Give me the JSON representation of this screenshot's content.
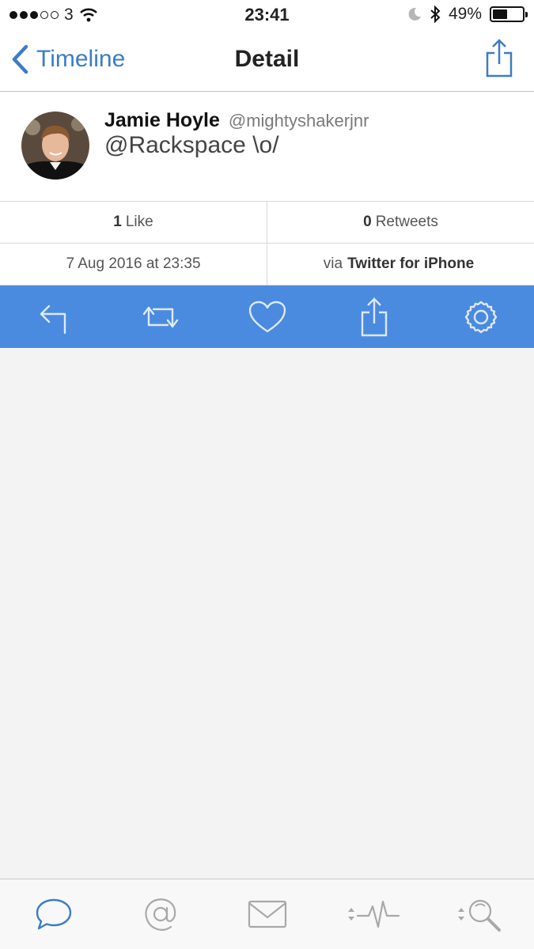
{
  "status_bar": {
    "carrier": "3",
    "time": "23:41",
    "battery": "49%",
    "battery_level": 0.49
  },
  "nav": {
    "back_label": "Timeline",
    "title": "Detail"
  },
  "tweet": {
    "name": "Jamie Hoyle",
    "handle": "@mightyshakerjnr",
    "text": "@Rackspace \\o/"
  },
  "stats": {
    "likes_count": "1",
    "likes_label": "Like",
    "retweets_count": "0",
    "retweets_label": "Retweets",
    "date": "7 Aug 2016 at 23:35",
    "via_prefix": "via",
    "via_client": "Twitter for iPhone"
  },
  "actions": [
    "reply-icon",
    "retweet-icon",
    "heart-icon",
    "share-icon",
    "gear-icon"
  ],
  "tabs": [
    "speech-bubble-icon",
    "at-sign-icon",
    "envelope-icon",
    "activity-icon",
    "search-icon"
  ],
  "colors": {
    "accent": "#3b7cc9",
    "action_bar": "#4a8be0",
    "tab_inactive": "#a8a8a8"
  }
}
